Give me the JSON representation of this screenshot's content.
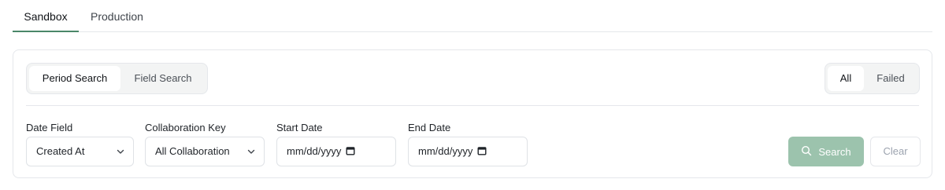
{
  "tabs": [
    {
      "label": "Sandbox",
      "active": true
    },
    {
      "label": "Production",
      "active": false
    }
  ],
  "search_mode": {
    "options": [
      "Period Search",
      "Field Search"
    ],
    "selected": "Period Search"
  },
  "status_filter": {
    "options": [
      "All",
      "Failed"
    ],
    "selected": "All"
  },
  "fields": {
    "date_field": {
      "label": "Date Field",
      "value": "Created At"
    },
    "collaboration_key": {
      "label": "Collaboration Key",
      "value": "All Collaboration"
    },
    "start_date": {
      "label": "Start Date",
      "value": "mm/dd/yyyy"
    },
    "end_date": {
      "label": "End Date",
      "value": "mm/dd/yyyy"
    }
  },
  "actions": {
    "search_label": "Search",
    "clear_label": "Clear"
  },
  "colors": {
    "accent": "#4a8768",
    "search_button_disabled": "#9cc3ad"
  },
  "icons": {
    "chevron": "chevron-down-icon",
    "calendar": "calendar-icon",
    "search": "search-icon"
  }
}
